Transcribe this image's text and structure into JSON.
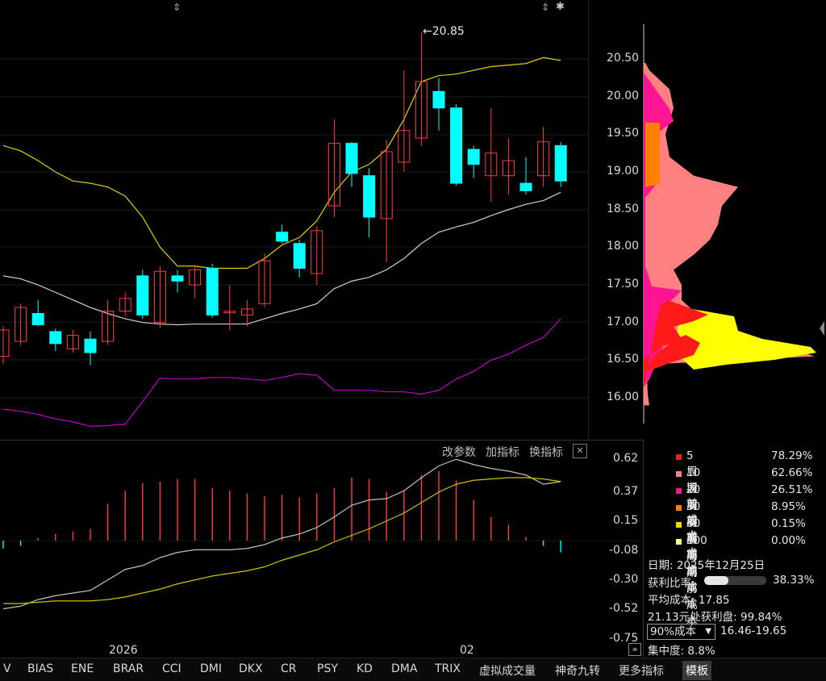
{
  "main": {
    "high_label": "20.85",
    "y_ticks": [
      "20.50",
      "20.00",
      "19.50",
      "19.00",
      "18.50",
      "18.00",
      "17.50",
      "17.00",
      "16.50",
      "16.00"
    ]
  },
  "sub": {
    "buttons": [
      "改参数",
      "加指标",
      "换指标"
    ],
    "close_glyph": "✕",
    "y_ticks": [
      "0.62",
      "0.37",
      "0.15",
      "-0.08",
      "-0.30",
      "-0.52",
      "-0.75"
    ]
  },
  "axis": {
    "labels": [
      "2026",
      "02"
    ]
  },
  "chip": {
    "legend": [
      {
        "label": "5周期前成本",
        "pct": "78.29%",
        "color": "#ff1a1a"
      },
      {
        "label": "10周期前成本",
        "pct": "62.66%",
        "color": "#ff8080"
      },
      {
        "label": "20周期前成本",
        "pct": "26.51%",
        "color": "#ff1493"
      },
      {
        "label": "30周期前成本",
        "pct": "8.95%",
        "color": "#ff8000"
      },
      {
        "label": "60周期前成本",
        "pct": "0.15%",
        "color": "#ffd700"
      },
      {
        "label": "100周期前成本",
        "pct": "0.00%",
        "color": "#ffff80"
      }
    ],
    "date_label": "日期:",
    "date_value": "2025年12月25日",
    "profit_ratio_label": "获利比率:",
    "profit_ratio_value": "38.33%",
    "profit_ratio_fraction": 0.3833,
    "avg_cost_label": "平均成本:",
    "avg_cost_value": "17.85",
    "profit_at_label": "21.13元处获利盘:",
    "profit_at_value": "99.84%",
    "cost_select": "90%成本",
    "cost_range": "16.46-19.65",
    "concentration_label": "集中度:",
    "concentration_value": "8.8%"
  },
  "tabs": [
    "V",
    "BIAS",
    "ENE",
    "BRAR",
    "CCI",
    "DMI",
    "DKX",
    "CR",
    "PSY",
    "KD",
    "DMA",
    "TRIX",
    "虚拟成交量",
    "神奇九转",
    "更多指标",
    "模板"
  ],
  "active_tab": "模板",
  "colors": {
    "up": "#ff3c3c",
    "down": "#00ffff",
    "upper_band": "#e0d000",
    "mid_band": "#d0d0d0",
    "lower_band": "#c000c0",
    "macd_fast": "#c0c0c0",
    "macd_slow": "#d0c000"
  },
  "chart_data": {
    "type": "candlestick",
    "ylim": [
      15.9,
      20.9
    ],
    "candles": [
      {
        "o": 16.55,
        "c": 16.9,
        "h": 16.95,
        "l": 16.45
      },
      {
        "o": 16.75,
        "c": 17.2,
        "h": 17.25,
        "l": 16.7
      },
      {
        "o": 17.12,
        "c": 16.97,
        "h": 17.3,
        "l": 16.95
      },
      {
        "o": 16.88,
        "c": 16.72,
        "h": 16.92,
        "l": 16.62
      },
      {
        "o": 16.65,
        "c": 16.83,
        "h": 16.9,
        "l": 16.6
      },
      {
        "o": 16.78,
        "c": 16.6,
        "h": 16.88,
        "l": 16.43
      },
      {
        "o": 16.75,
        "c": 17.15,
        "h": 17.3,
        "l": 16.7
      },
      {
        "o": 17.15,
        "c": 17.32,
        "h": 17.4,
        "l": 17.08
      },
      {
        "o": 17.62,
        "c": 17.1,
        "h": 17.7,
        "l": 17.05
      },
      {
        "o": 17.0,
        "c": 17.68,
        "h": 17.75,
        "l": 16.93
      },
      {
        "o": 17.62,
        "c": 17.55,
        "h": 17.7,
        "l": 17.4
      },
      {
        "o": 17.5,
        "c": 17.7,
        "h": 17.75,
        "l": 17.32
      },
      {
        "o": 17.72,
        "c": 17.1,
        "h": 17.78,
        "l": 17.06
      },
      {
        "o": 17.13,
        "c": 17.15,
        "h": 17.5,
        "l": 16.9
      },
      {
        "o": 17.1,
        "c": 17.18,
        "h": 17.3,
        "l": 16.95
      },
      {
        "o": 17.25,
        "c": 17.82,
        "h": 17.92,
        "l": 17.2
      },
      {
        "o": 18.2,
        "c": 18.08,
        "h": 18.3,
        "l": 18.05
      },
      {
        "o": 18.05,
        "c": 17.72,
        "h": 18.1,
        "l": 17.6
      },
      {
        "o": 17.65,
        "c": 18.22,
        "h": 18.28,
        "l": 17.5
      },
      {
        "o": 18.55,
        "c": 19.38,
        "h": 19.7,
        "l": 18.4
      },
      {
        "o": 19.38,
        "c": 18.98,
        "h": 19.4,
        "l": 18.8
      },
      {
        "o": 18.95,
        "c": 18.4,
        "h": 19.05,
        "l": 18.13
      },
      {
        "o": 18.38,
        "c": 19.27,
        "h": 19.43,
        "l": 17.8
      },
      {
        "o": 19.13,
        "c": 19.55,
        "h": 20.35,
        "l": 19.0
      },
      {
        "o": 19.45,
        "c": 20.2,
        "h": 20.85,
        "l": 19.35
      },
      {
        "o": 20.07,
        "c": 19.85,
        "h": 20.25,
        "l": 19.55
      },
      {
        "o": 19.85,
        "c": 18.85,
        "h": 19.9,
        "l": 18.82
      },
      {
        "o": 19.3,
        "c": 19.1,
        "h": 19.35,
        "l": 18.92
      },
      {
        "o": 18.95,
        "c": 19.25,
        "h": 19.85,
        "l": 18.6
      },
      {
        "o": 18.95,
        "c": 19.15,
        "h": 19.45,
        "l": 18.7
      },
      {
        "o": 18.85,
        "c": 18.75,
        "h": 19.2,
        "l": 18.7
      },
      {
        "o": 18.95,
        "c": 19.4,
        "h": 19.6,
        "l": 18.8
      },
      {
        "o": 19.35,
        "c": 18.88,
        "h": 19.4,
        "l": 18.8
      }
    ],
    "upper_band": [
      19.35,
      19.28,
      19.15,
      19.0,
      18.88,
      18.85,
      18.8,
      18.68,
      18.4,
      18.0,
      17.75,
      17.75,
      17.72,
      17.72,
      17.72,
      17.85,
      18.03,
      18.13,
      18.35,
      18.73,
      19.0,
      19.1,
      19.3,
      19.7,
      20.2,
      20.28,
      20.3,
      20.35,
      20.4,
      20.42,
      20.44,
      20.52,
      20.48
    ],
    "mid_band": [
      17.62,
      17.58,
      17.5,
      17.4,
      17.3,
      17.2,
      17.12,
      17.05,
      17.0,
      16.98,
      16.97,
      16.98,
      16.98,
      16.98,
      16.98,
      17.05,
      17.12,
      17.18,
      17.25,
      17.45,
      17.55,
      17.6,
      17.7,
      17.85,
      18.05,
      18.2,
      18.27,
      18.33,
      18.42,
      18.5,
      18.57,
      18.62,
      18.73
    ],
    "lower_band": [
      15.85,
      15.82,
      15.78,
      15.72,
      15.68,
      15.62,
      15.63,
      15.65,
      15.95,
      16.26,
      16.25,
      16.25,
      16.27,
      16.27,
      16.25,
      16.23,
      16.27,
      16.32,
      16.3,
      16.1,
      16.1,
      16.1,
      16.08,
      16.08,
      16.05,
      16.1,
      16.25,
      16.35,
      16.5,
      16.58,
      16.7,
      16.8,
      17.05
    ],
    "macd_fast": [
      -0.52,
      -0.5,
      -0.45,
      -0.42,
      -0.4,
      -0.38,
      -0.3,
      -0.22,
      -0.19,
      -0.13,
      -0.09,
      -0.07,
      -0.07,
      -0.07,
      -0.06,
      -0.03,
      0.02,
      0.05,
      0.1,
      0.18,
      0.27,
      0.31,
      0.32,
      0.38,
      0.48,
      0.57,
      0.62,
      0.58,
      0.55,
      0.53,
      0.5,
      0.43,
      0.45
    ],
    "macd_slow": [
      -0.48,
      -0.48,
      -0.47,
      -0.46,
      -0.46,
      -0.46,
      -0.45,
      -0.43,
      -0.4,
      -0.37,
      -0.33,
      -0.3,
      -0.27,
      -0.25,
      -0.23,
      -0.2,
      -0.15,
      -0.11,
      -0.07,
      -0.01,
      0.04,
      0.09,
      0.15,
      0.21,
      0.29,
      0.37,
      0.43,
      0.46,
      0.47,
      0.48,
      0.48,
      0.47,
      0.45
    ],
    "macd_hist": [
      -0.06,
      -0.04,
      0.02,
      0.05,
      0.07,
      0.09,
      0.28,
      0.38,
      0.44,
      0.45,
      0.47,
      0.47,
      0.4,
      0.38,
      0.36,
      0.34,
      0.35,
      0.33,
      0.36,
      0.4,
      0.48,
      0.47,
      0.37,
      0.38,
      0.5,
      0.53,
      0.46,
      0.31,
      0.18,
      0.12,
      0.03,
      -0.04,
      -0.09
    ],
    "chip_curve": [
      [
        15.9,
        805,
        0
      ],
      [
        16.05,
        803,
        0
      ],
      [
        16.3,
        802,
        0
      ],
      [
        16.45,
        818,
        0.9
      ],
      [
        16.55,
        1010,
        1.0
      ],
      [
        16.62,
        990,
        0.95
      ],
      [
        16.7,
        940,
        0.9
      ],
      [
        16.8,
        920,
        0.85
      ],
      [
        16.9,
        905,
        0.8
      ],
      [
        17.0,
        880,
        0.75
      ],
      [
        17.15,
        860,
        0.7
      ],
      [
        17.3,
        845,
        0.6
      ],
      [
        17.5,
        845,
        0.5
      ],
      [
        17.7,
        835,
        0.4
      ],
      [
        17.9,
        860,
        0.3
      ],
      [
        18.1,
        880,
        0.2
      ],
      [
        18.3,
        890,
        0.15
      ],
      [
        18.55,
        895,
        0.1
      ],
      [
        18.8,
        915,
        0.08
      ],
      [
        18.95,
        860,
        0.05
      ],
      [
        19.2,
        830,
        0.03
      ],
      [
        19.5,
        825,
        0.02
      ],
      [
        19.85,
        835,
        0.01
      ],
      [
        20.1,
        830,
        0
      ],
      [
        20.35,
        805,
        0
      ],
      [
        20.45,
        800,
        0
      ]
    ]
  }
}
